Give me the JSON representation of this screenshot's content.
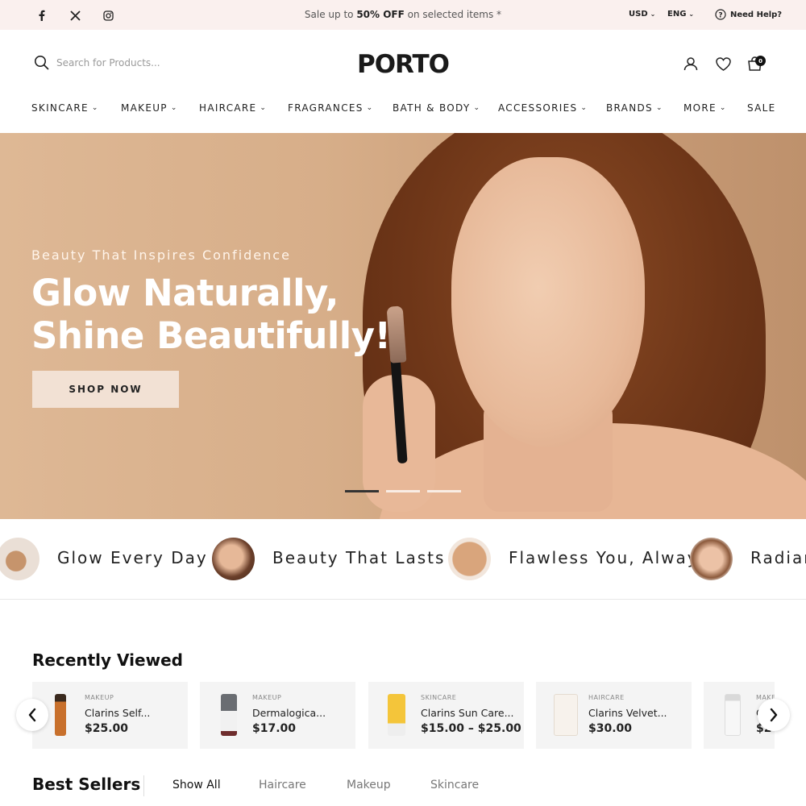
{
  "topbar": {
    "promo_prefix": "Sale up to ",
    "promo_bold": "50% OFF",
    "promo_suffix": " on selected items *",
    "currency": "USD",
    "language": "ENG",
    "help": "Need Help?",
    "social": [
      "facebook-icon",
      "x-icon",
      "instagram-icon"
    ]
  },
  "header": {
    "logo": "PORTO",
    "search_placeholder": "Search for Products...",
    "cart_count": "0"
  },
  "nav": {
    "items": [
      {
        "label": "SKINCARE"
      },
      {
        "label": "MAKEUP"
      },
      {
        "label": "HAIRCARE"
      },
      {
        "label": "FRAGRANCES"
      },
      {
        "label": "BATH & BODY"
      },
      {
        "label": "ACCESSORIES"
      },
      {
        "label": "BRANDS"
      },
      {
        "label": "MORE"
      }
    ],
    "sale": "SALE"
  },
  "hero": {
    "eyebrow": "Beauty That Inspires Confidence",
    "headline_line1": "Glow Naturally,",
    "headline_line2": "Shine Beautifully!",
    "cta": "SHOP NOW",
    "slide_active": 1,
    "slide_count": 3
  },
  "marquee": {
    "items": [
      "Glow Every Day",
      "Beauty That Lasts",
      "Flawless You, Alway",
      "Radiar"
    ]
  },
  "recently_viewed": {
    "title": "Recently Viewed",
    "products": [
      {
        "category": "MAKEUP",
        "name": "Clarins Self...",
        "price": "$25.00"
      },
      {
        "category": "MAKEUP",
        "name": "Dermalogica...",
        "price": "$17.00"
      },
      {
        "category": "SKINCARE",
        "name": "Clarins Sun Care...",
        "price": "$15.00 – $25.00"
      },
      {
        "category": "HAIRCARE",
        "name": "Clarins Velvet...",
        "price": "$30.00"
      },
      {
        "category": "MAKE",
        "name": "C",
        "price": "$2"
      }
    ]
  },
  "best_sellers": {
    "title": "Best Sellers",
    "tabs": [
      "Show All",
      "Haircare",
      "Makeup",
      "Skincare"
    ]
  },
  "colors": {
    "topbar_bg": "#faf0ee",
    "hero_bg": "#d7ae89",
    "cta_bg": "#f2e1d4",
    "card_bg": "#f4f4f4"
  }
}
